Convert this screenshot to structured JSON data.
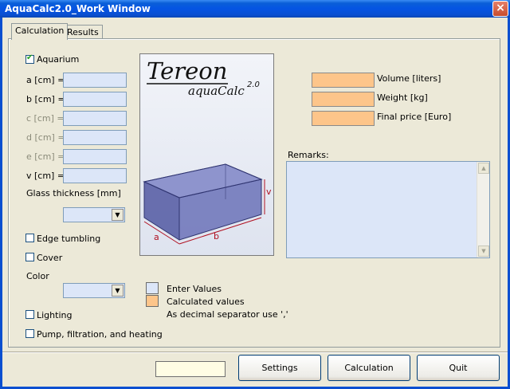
{
  "window": {
    "title": "AquaCalc2.0_Work Window",
    "close_glyph": "×"
  },
  "tabs": [
    {
      "label": "Calculation"
    },
    {
      "label": "Results"
    }
  ],
  "left": {
    "aquarium_label": "Aquarium",
    "aquarium_checked": true,
    "fields": [
      {
        "label": "a [cm] =",
        "value": ""
      },
      {
        "label": "b [cm] =",
        "value": ""
      },
      {
        "label": "c [cm] =",
        "value": ""
      },
      {
        "label": "d [cm] =",
        "value": ""
      },
      {
        "label": "e [cm] =",
        "value": ""
      },
      {
        "label": "v [cm] =",
        "value": ""
      }
    ],
    "glass_label": "Glass thickness [mm]",
    "glass_value": "",
    "edge_label": "Edge tumbling",
    "cover_label": "Cover",
    "color_label": "Color",
    "color_value": "",
    "lighting_label": "Lighting",
    "pump_label": "Pump, filtration, and heating"
  },
  "logo": {
    "brand": "Tereon",
    "product": "aquaCalc",
    "version": "2.0"
  },
  "diagram": {
    "label_a": "a",
    "label_b": "b",
    "label_v": "v"
  },
  "outputs": [
    {
      "label": "Volume [liters]",
      "value": ""
    },
    {
      "label": "Weight [kg]",
      "value": ""
    },
    {
      "label": "Final price [Euro]",
      "value": ""
    }
  ],
  "remarks": {
    "label": "Remarks:",
    "value": ""
  },
  "legend": {
    "enter": "Enter Values",
    "calculated": "Calculated values",
    "decimal_note": "As decimal separator use ','"
  },
  "footer": {
    "status_value": "",
    "settings_label": "Settings",
    "calculation_label": "Calculation",
    "quit_label": "Quit"
  },
  "colors": {
    "input": "#dce6f8",
    "output": "#fdc58a",
    "titlebar": "#0554e3",
    "diagram_label": "#b01020"
  }
}
